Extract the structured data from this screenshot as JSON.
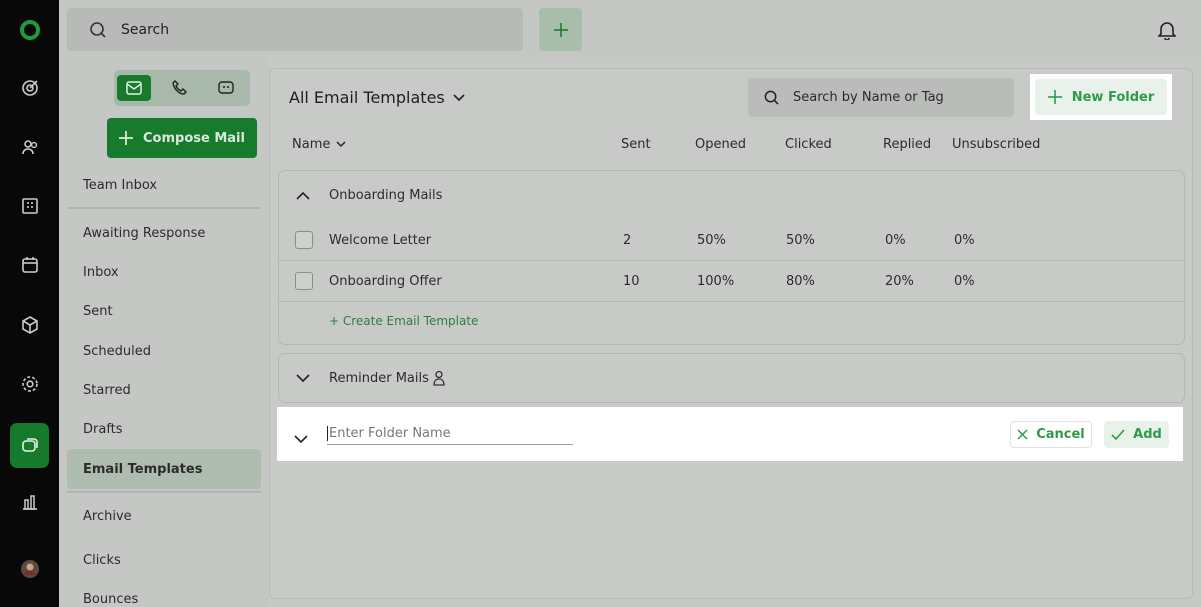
{
  "topbar": {
    "search_label": "Search"
  },
  "sidebar": {
    "compose_label": "Compose Mail",
    "items": [
      {
        "label": "Team Inbox"
      },
      {
        "label": "Awaiting Response"
      },
      {
        "label": "Inbox"
      },
      {
        "label": "Sent"
      },
      {
        "label": "Scheduled"
      },
      {
        "label": "Starred"
      },
      {
        "label": "Drafts"
      },
      {
        "label": "Email Templates",
        "active": true
      },
      {
        "label": "Archive"
      },
      {
        "label": "Clicks"
      },
      {
        "label": "Bounces"
      }
    ]
  },
  "main": {
    "title": "All Email Templates",
    "search_placeholder": "Search by Name or Tag",
    "new_folder_label": "New Folder",
    "columns": [
      "Name",
      "Sent",
      "Opened",
      "Clicked",
      "Replied",
      "Unsubscribed"
    ],
    "folders": [
      {
        "name": "Onboarding Mails",
        "expanded": true,
        "templates": [
          {
            "name": "Welcome Letter",
            "sent": "2",
            "opened": "50%",
            "clicked": "50%",
            "replied": "0%",
            "unsubscribed": "0%"
          },
          {
            "name": "Onboarding Offer",
            "sent": "10",
            "opened": "100%",
            "clicked": "80%",
            "replied": "20%",
            "unsubscribed": "0%"
          }
        ],
        "create_link": "+ Create Email Template"
      },
      {
        "name": "Reminder Mails",
        "expanded": false
      }
    ],
    "new_folder_row": {
      "placeholder": "Enter Folder Name",
      "cancel_label": "Cancel",
      "add_label": "Add"
    }
  },
  "colors": {
    "brand_green": "#177a2d",
    "accent_green": "#2f9a4b",
    "highlight": "#ffffff"
  },
  "icons": [
    "logo-icon",
    "target-icon",
    "contacts-icon",
    "building-icon",
    "calendar-icon",
    "box-icon",
    "gear-icon",
    "chat-icon",
    "chart-icon",
    "avatar",
    "search-icon",
    "plus-icon",
    "bell-icon",
    "mail-icon",
    "phone-icon",
    "chat-bot-icon",
    "chevron-down-icon",
    "chevron-up-icon",
    "person-icon",
    "close-icon",
    "check-icon"
  ]
}
